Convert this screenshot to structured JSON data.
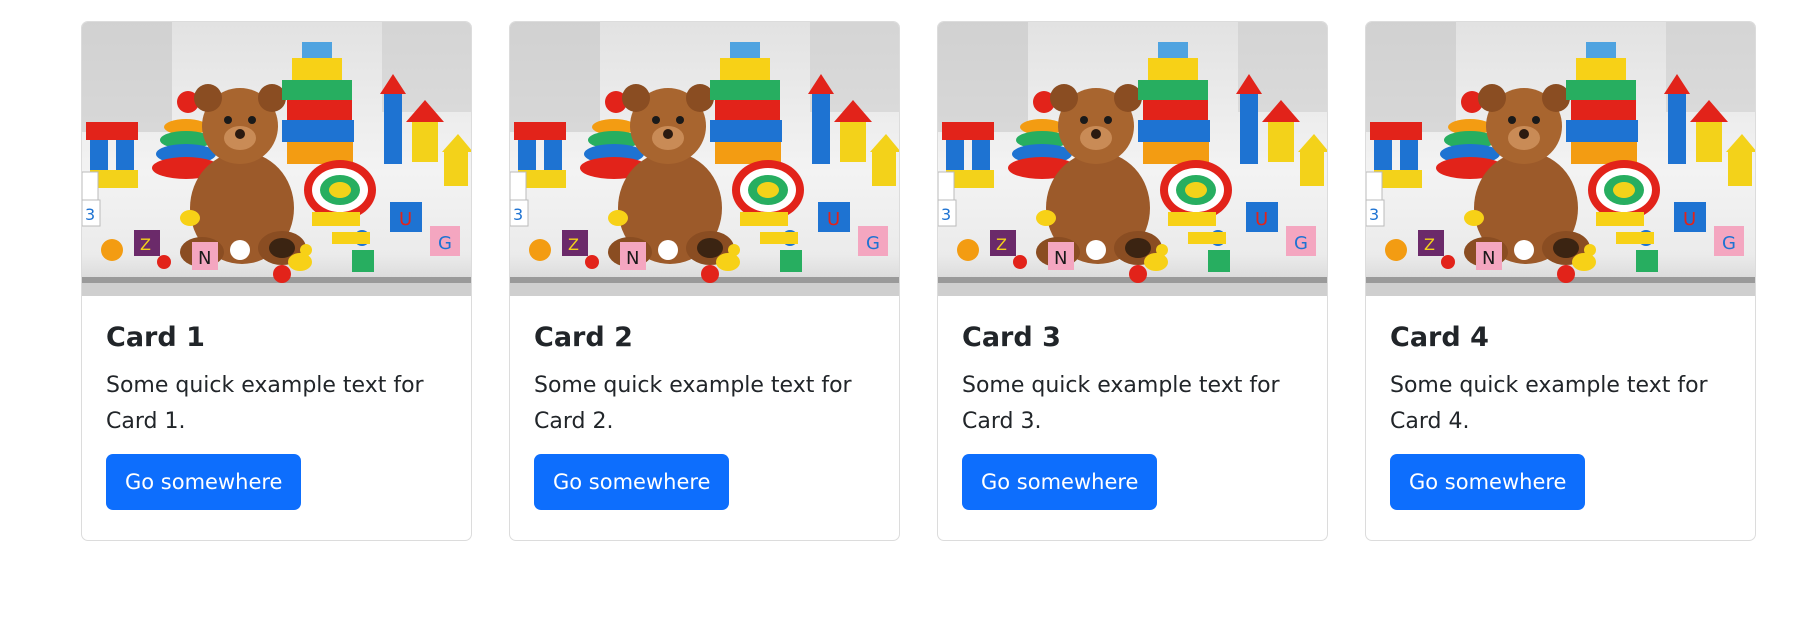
{
  "colors": {
    "button_bg": "#0d6efd",
    "button_text": "#ffffff",
    "card_border": "#dcdcdc",
    "text": "#212529"
  },
  "cards": [
    {
      "image": "toys-photo",
      "title": "Card 1",
      "text": "Some quick example text for Card 1.",
      "button_label": "Go somewhere"
    },
    {
      "image": "toys-photo",
      "title": "Card 2",
      "text": "Some quick example text for Card 2.",
      "button_label": "Go somewhere"
    },
    {
      "image": "toys-photo",
      "title": "Card 3",
      "text": "Some quick example text for Card 3.",
      "button_label": "Go somewhere"
    },
    {
      "image": "toys-photo",
      "title": "Card 4",
      "text": "Some quick example text for Card 4.",
      "button_label": "Go somewhere"
    }
  ]
}
